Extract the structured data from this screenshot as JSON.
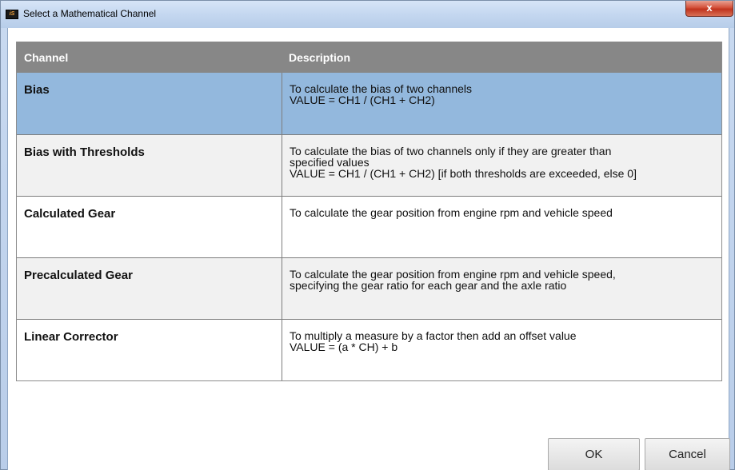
{
  "window": {
    "title": "Select a Mathematical Channel",
    "app_icon_text": "iS",
    "close_glyph": "x"
  },
  "table": {
    "headers": {
      "channel": "Channel",
      "description": "Description"
    },
    "rows": [
      {
        "channel": "Bias",
        "description": [
          "To calculate the bias of two channels",
          "VALUE = CH1 / (CH1 + CH2)"
        ],
        "selected": true
      },
      {
        "channel": "Bias with Thresholds",
        "description": [
          "To calculate the bias of two channels only if they are greater than",
          "specified values",
          "VALUE = CH1 / (CH1 + CH2) [if both thresholds are exceeded, else 0]"
        ],
        "selected": false
      },
      {
        "channel": "Calculated Gear",
        "description": [
          "To calculate the gear position from engine rpm and vehicle speed"
        ],
        "selected": false
      },
      {
        "channel": "Precalculated Gear",
        "description": [
          "To calculate the gear position from engine rpm and vehicle speed,",
          "specifying the gear ratio for each gear and the axle ratio"
        ],
        "selected": false
      },
      {
        "channel": "Linear Corrector",
        "description": [
          "To multiply a measure by a factor then add an offset value",
          "VALUE = (a * CH) + b"
        ],
        "selected": false
      }
    ]
  },
  "buttons": {
    "ok": "OK",
    "cancel": "Cancel"
  },
  "colors": {
    "header_bg": "#878787",
    "selected_row": "#93b8dd",
    "close_button": "#c0341e"
  }
}
